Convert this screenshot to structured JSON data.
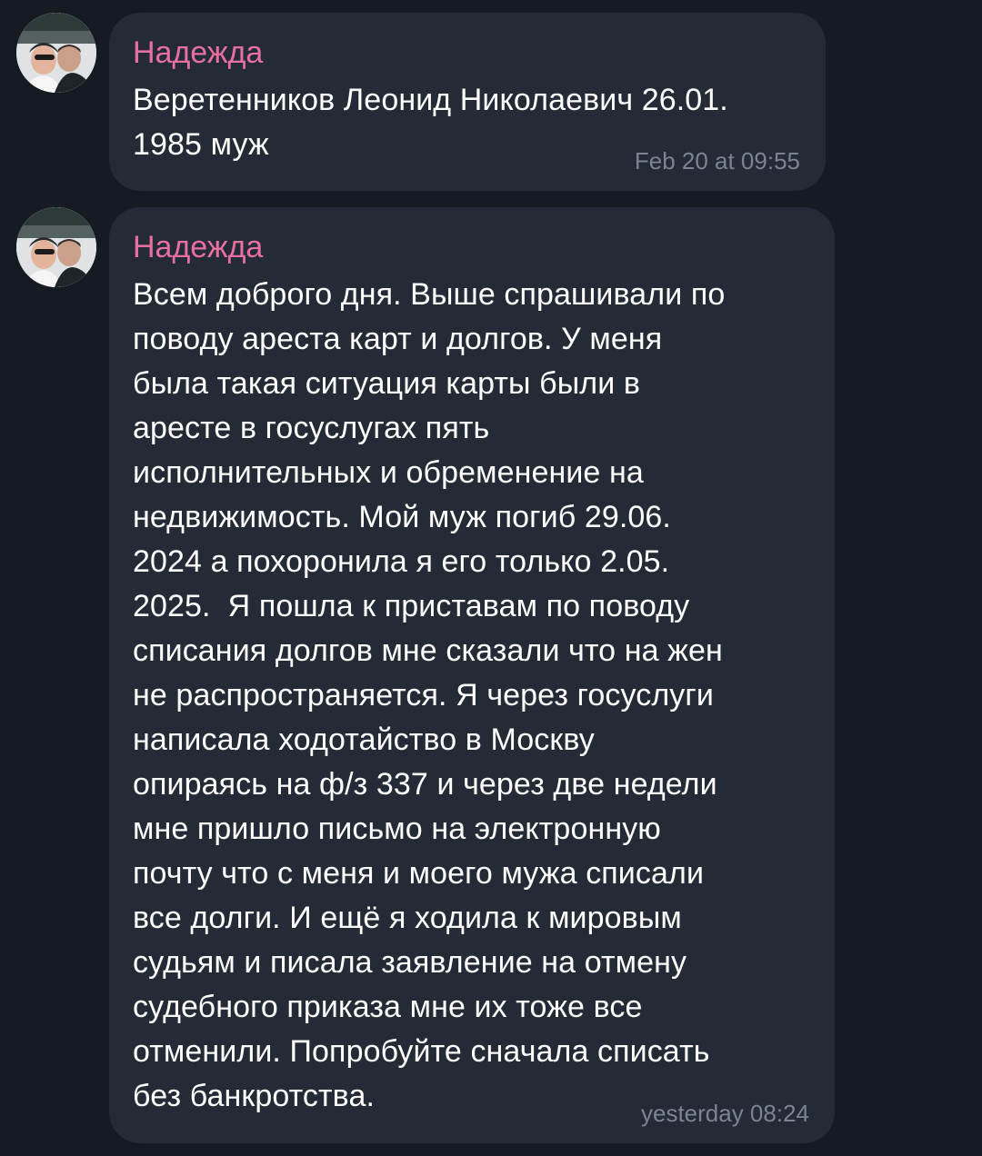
{
  "messages": [
    {
      "sender": "Надежда",
      "text": "Веретенников Леонид Николаевич 26.01.\n1985 муж",
      "time": "Feb 20 at 09:55"
    },
    {
      "sender": "Надежда",
      "text": "Всем доброго дня. Выше спрашивали по\nповоду ареста карт и долгов. У меня\nбыла такая ситуация карты были в\nаресте в госуслугах пять\nисполнительных и обременение на\nнедвижимость. Мой муж погиб 29.06.\n2024 а похоронила я его только 2.05.\n2025.  Я пошла к приставам по поводу\nсписания долгов мне сказали что на жен\nне распространяется. Я через госуслуги\nнаписала ходотайство в Москву\nопираясь на ф/з 337 и через две недели\nмне пришло письмо на электронную\nпочту что с меня и моего мужа списали\nвсе долги. И ещё я ходила к мировым\nсудьям и писала заявление на отмену\nсудебного приказа мне их тоже все\nотменили. Попробуйте сначала списать\nбез банкротства.",
      "time": "yesterday 08:24"
    }
  ],
  "colors": {
    "background": "#151a23",
    "bubble": "#242a36",
    "sender_name": "#e8709f",
    "text": "#ffffff",
    "timestamp": "#7a8494"
  }
}
